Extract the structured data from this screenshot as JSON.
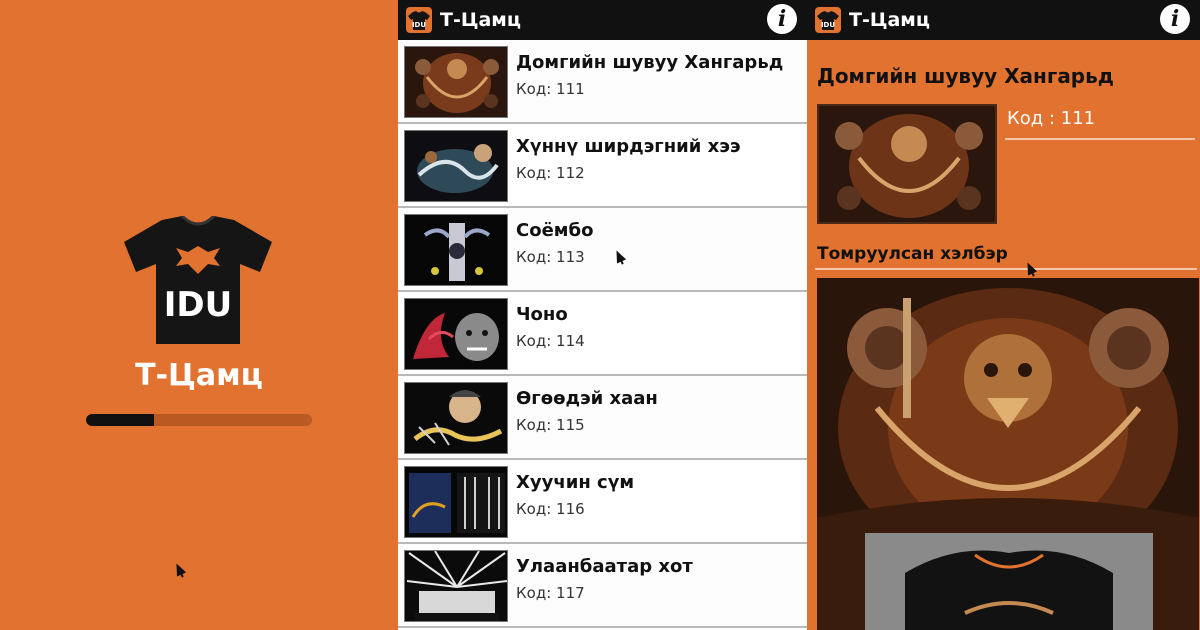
{
  "app": {
    "title": "Т-Цамц"
  },
  "splash": {
    "title": "Т-Цамц",
    "logo_text": "IDU",
    "progress": 0.3
  },
  "list_screen": {
    "header_title": "Т-Цамц",
    "info_label": "i",
    "items": [
      {
        "title": "Домгийн шувуу Хангарьд",
        "code": "Код: 111"
      },
      {
        "title": "Хүннү ширдэгний хээ",
        "code": "Код: 112"
      },
      {
        "title": "Соёмбо",
        "code": "Код: 113"
      },
      {
        "title": "Чоно",
        "code": "Код: 114"
      },
      {
        "title": "Өгөөдэй хаан",
        "code": "Код: 115"
      },
      {
        "title": "Хуучин сүм",
        "code": "Код: 116"
      },
      {
        "title": "Улаанбаатар хот",
        "code": "Код: 117"
      }
    ]
  },
  "detail_screen": {
    "header_title": "Т-Цамц",
    "info_label": "i",
    "title": "Домгийн шувуу Хангарьд",
    "code": "Код : 111",
    "section_title": "Томруулсан хэлбэр"
  },
  "colors": {
    "accent": "#e2722f",
    "bar": "#111111",
    "list_bg": "#ffffff"
  },
  "icons": [
    "tshirt-icon",
    "info-icon",
    "cursor-icon"
  ]
}
